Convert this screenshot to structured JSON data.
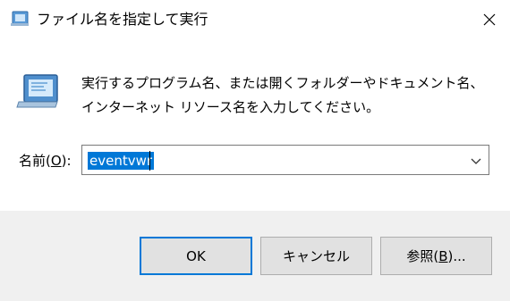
{
  "window": {
    "title": "ファイル名を指定して実行",
    "title_icon": "run-icon",
    "close_icon": "close-icon"
  },
  "content": {
    "icon": "run-icon",
    "description": "実行するプログラム名、または開くフォルダーやドキュメント名、インターネット リソース名を入力してください。",
    "open_label_prefix": "名前(",
    "open_label_accel": "O",
    "open_label_suffix": "):",
    "input_value": "eventvwr",
    "dropdown_icon": "chevron-down-icon"
  },
  "buttons": {
    "ok_label": "OK",
    "cancel_label": "キャンセル",
    "browse_prefix": "参照(",
    "browse_accel": "B",
    "browse_suffix": ")..."
  },
  "colors": {
    "accent": "#0078d7",
    "footer_bg": "#f0f0f0",
    "button_bg": "#e1e1e1"
  }
}
